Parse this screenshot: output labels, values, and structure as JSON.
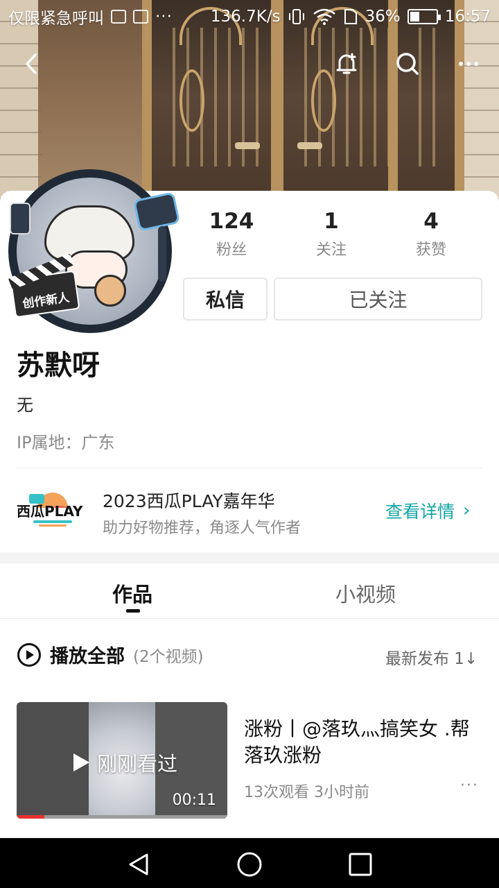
{
  "status_bar": {
    "carrier": "仅限紧急呼叫",
    "dots": "···",
    "speed": "136.7K/s",
    "battery_percent": "36%",
    "battery_level": 0.36,
    "time": "16:57"
  },
  "header_icons": [
    "back-arrow-icon",
    "bell-add-icon",
    "search-icon",
    "more-icon"
  ],
  "profile": {
    "avatar_badge": "创作新人",
    "stats": [
      {
        "num": "124",
        "label": "粉丝"
      },
      {
        "num": "1",
        "label": "关注"
      },
      {
        "num": "4",
        "label": "获赞"
      }
    ],
    "message_button": "私信",
    "follow_button": "已关注",
    "name": "苏默呀",
    "bio": "无",
    "ip": "IP属地：广东"
  },
  "promo": {
    "title": "2023西瓜PLAY嘉年华",
    "subtitle": "助力好物推荐，角逐人气作者",
    "link": "查看详情",
    "link_chevron": "›",
    "accent_color": "#15a5a5"
  },
  "tabs": [
    {
      "label": "作品",
      "active": true
    },
    {
      "label": "小视频",
      "active": false
    }
  ],
  "list_header": {
    "play_all": "播放全部",
    "count": "(2个视频)",
    "sort": "最新发布 1↓"
  },
  "videos": [
    {
      "watched_label": "刚刚看过",
      "duration": "00:11",
      "watched_progress": 0.13,
      "title": "涨粉丨@落玖灬搞笑女 .帮落玖涨粉",
      "meta": "13次观看  3小时前",
      "more": "···"
    }
  ]
}
